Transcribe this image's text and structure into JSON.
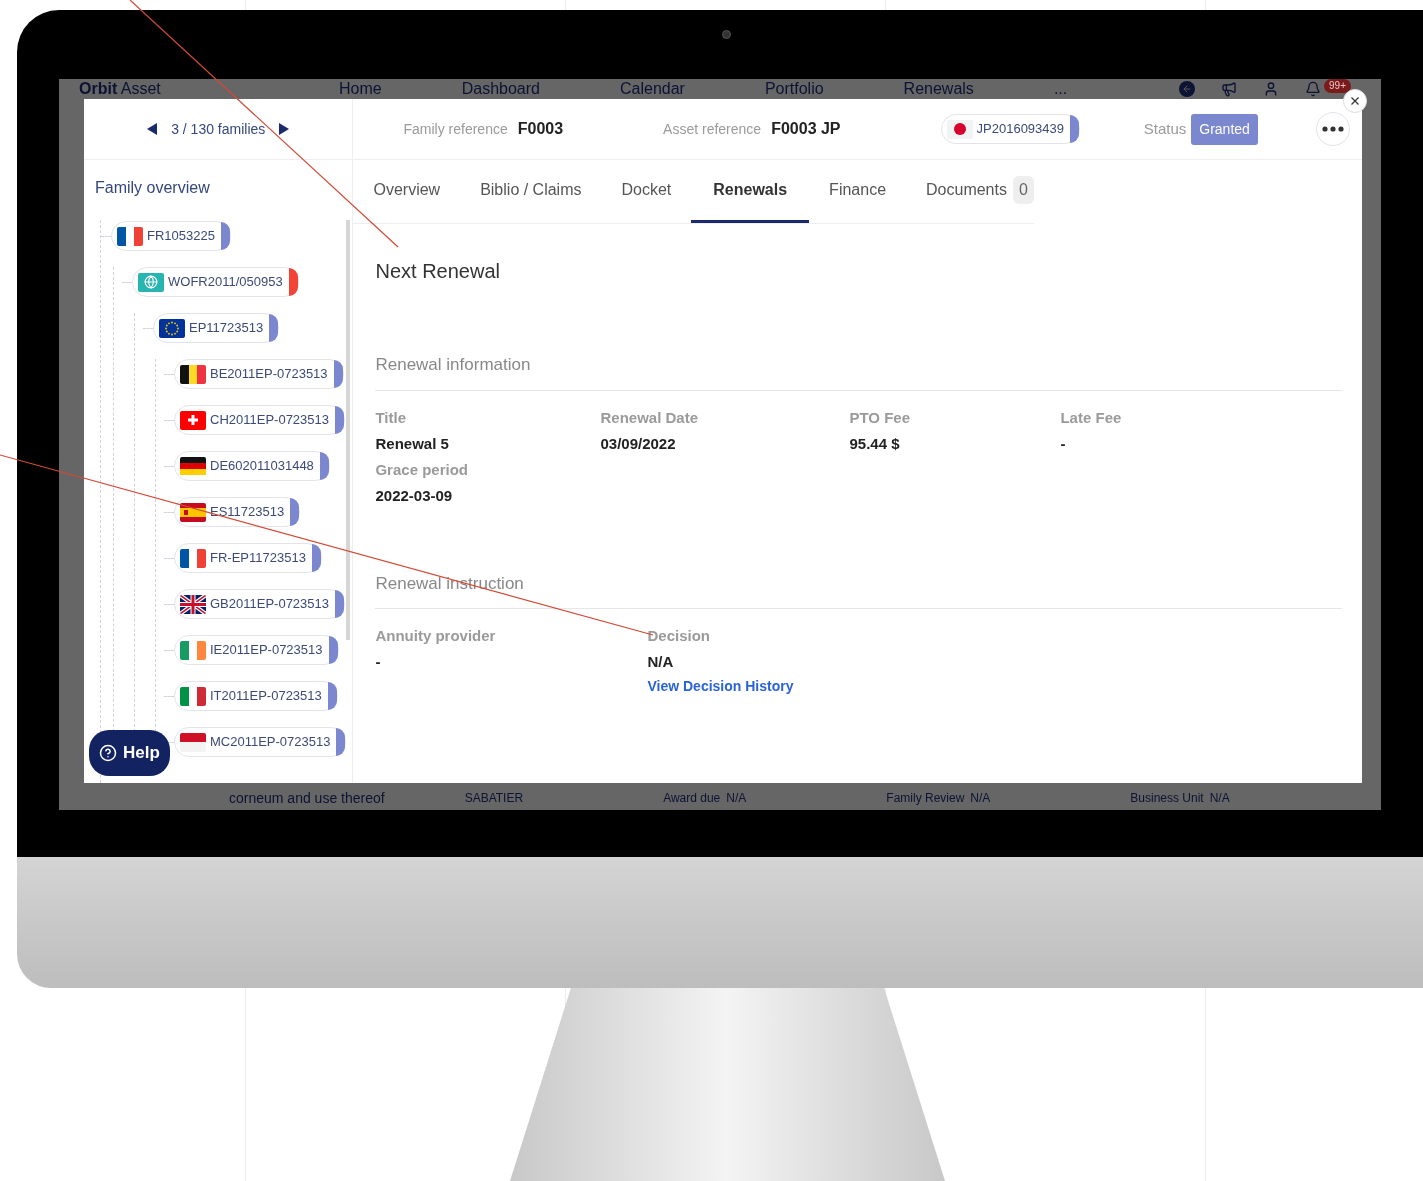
{
  "background_app": {
    "logo": {
      "bold": "Orbit",
      "light": "Asset"
    },
    "nav": [
      "Home",
      "Dashboard",
      "Calendar",
      "Portfolio",
      "Renewals",
      "..."
    ],
    "notification_badge": "99+",
    "footer": {
      "title": "corneum and use thereof",
      "owner": "SABATIER",
      "fields": [
        {
          "label": "Award due",
          "value": "N/A"
        },
        {
          "label": "Family Review",
          "value": "N/A"
        },
        {
          "label": "Business Unit",
          "value": "N/A"
        }
      ]
    }
  },
  "modal": {
    "pager": {
      "text": "3 / 130 families"
    },
    "header": {
      "family_reference": {
        "label": "Family reference",
        "value": "F0003"
      },
      "asset_reference": {
        "label": "Asset reference",
        "value": "F0003 JP"
      },
      "asset_chip": {
        "label": "JP2016093439",
        "kind": "jp",
        "color": "#7b87cf"
      },
      "status": {
        "label": "Status",
        "value": "Granted"
      }
    },
    "sidebar": {
      "title": "Family overview",
      "tree": [
        {
          "label": "FR1053225",
          "kind": "fr",
          "color": "#7b87cf",
          "children": [
            {
              "label": "WOFR2011/050953",
              "kind": "wo",
              "color": "#f44336",
              "children": [
                {
                  "label": "EP11723513",
                  "kind": "eu",
                  "color": "#7b87cf",
                  "children": [
                    {
                      "label": "BE2011EP-0723513",
                      "kind": "be",
                      "color": "#7b87cf"
                    },
                    {
                      "label": "CH2011EP-0723513",
                      "kind": "ch",
                      "color": "#7b87cf"
                    },
                    {
                      "label": "DE602011031448",
                      "kind": "de",
                      "color": "#7b87cf"
                    },
                    {
                      "label": "ES11723513",
                      "kind": "es",
                      "color": "#7b87cf"
                    },
                    {
                      "label": "FR-EP11723513",
                      "kind": "fr",
                      "color": "#7b87cf"
                    },
                    {
                      "label": "GB2011EP-0723513",
                      "kind": "gb",
                      "color": "#7b87cf"
                    },
                    {
                      "label": "IE2011EP-0723513",
                      "kind": "ie",
                      "color": "#7b87cf"
                    },
                    {
                      "label": "IT2011EP-0723513",
                      "kind": "it",
                      "color": "#7b87cf"
                    },
                    {
                      "label": "MC2011EP-0723513",
                      "kind": "mc",
                      "color": "#7b87cf"
                    }
                  ]
                }
              ]
            }
          ]
        }
      ]
    },
    "help_button": "Help",
    "tabs": [
      {
        "label": "Overview",
        "selected": false
      },
      {
        "label": "Biblio / Claims",
        "selected": false
      },
      {
        "label": "Docket",
        "selected": false
      },
      {
        "label": "Renewals",
        "selected": true
      },
      {
        "label": "Finance",
        "selected": false
      },
      {
        "label": "Documents",
        "selected": false,
        "count": "0"
      }
    ],
    "heading": "Next Renewal",
    "renewal_information": {
      "title": "Renewal information",
      "fields": [
        {
          "label": "Title",
          "value": "Renewal 5"
        },
        {
          "label": "Renewal Date",
          "value": "03/09/2022"
        },
        {
          "label": "PTO Fee",
          "value": "95.44 $"
        },
        {
          "label": "Late Fee",
          "value": "-"
        },
        {
          "label": "Grace period",
          "value": "2022-03-09"
        }
      ]
    },
    "renewal_instruction": {
      "title": "Renewal instruction",
      "fields": [
        {
          "label": "Annuity provider",
          "value": "-"
        },
        {
          "label": "Decision",
          "value": "N/A",
          "link": "View Decision History"
        }
      ]
    }
  }
}
